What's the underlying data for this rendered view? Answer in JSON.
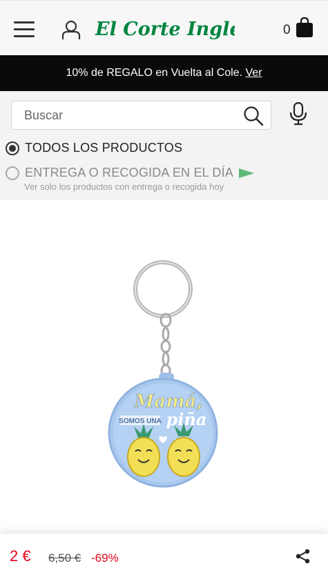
{
  "header": {
    "brand_name": "El Corte Inglés",
    "cart_count": "0",
    "brand_color": "#00853f"
  },
  "promo": {
    "text": "10% de REGALO en Vuelta al Cole.",
    "link_label": "Ver"
  },
  "search": {
    "placeholder": "Buscar"
  },
  "filters": {
    "all_products": "TODOS LOS PRODUCTOS",
    "same_day": "ENTREGA O RECOGIDA EN EL DÍA",
    "same_day_sub": "Ver solo los productos con entrega o recogida hoy"
  },
  "product": {
    "image_text_top": "Mamá,",
    "image_text_mid": "SOMOS UNA",
    "image_text_bottom": "piña"
  },
  "pricing": {
    "price": "2 €",
    "old_price": "6,50 €",
    "discount": "-69%",
    "sale_color": "#e3061b"
  },
  "icons": {
    "menu": "hamburger-menu-icon",
    "user": "user-icon",
    "bag": "shopping-bag-icon",
    "search": "search-icon",
    "mic": "microphone-icon",
    "share": "share-icon"
  }
}
